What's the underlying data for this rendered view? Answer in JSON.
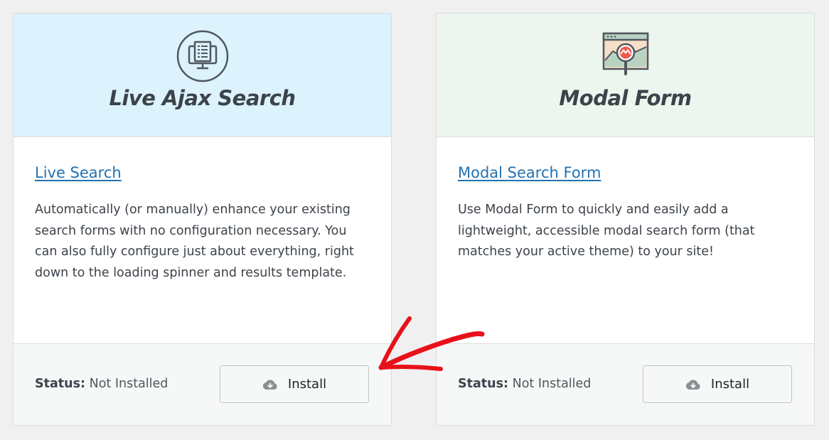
{
  "cards": [
    {
      "header_title": "Live Ajax Search",
      "header_color": "#dcf2fc",
      "icon": "document-search-icon",
      "link_label": "Live Search",
      "description": "Automatically (or manually) enhance your existing search forms with no configuration necessary. You can also fully configure just about everything, right down to the loading spinner and results template.",
      "status_label": "Status:",
      "status_value": "Not Installed",
      "button_label": "Install",
      "button_icon": "cloud-download-icon"
    },
    {
      "header_title": "Modal Form",
      "header_color": "#ecf6ee",
      "icon": "browser-magnifier-icon",
      "link_label": "Modal Search Form",
      "description": "Use Modal Form to quickly and easily add a lightweight, accessible modal search form (that matches your active theme) to your site!",
      "status_label": "Status:",
      "status_value": "Not Installed",
      "button_label": "Install",
      "button_icon": "cloud-download-icon"
    }
  ],
  "annotation": {
    "type": "red-arrow-pointing-left",
    "color": "#e8101a"
  },
  "colors": {
    "link": "#2271b1",
    "page_background": "#f0f0f1"
  }
}
